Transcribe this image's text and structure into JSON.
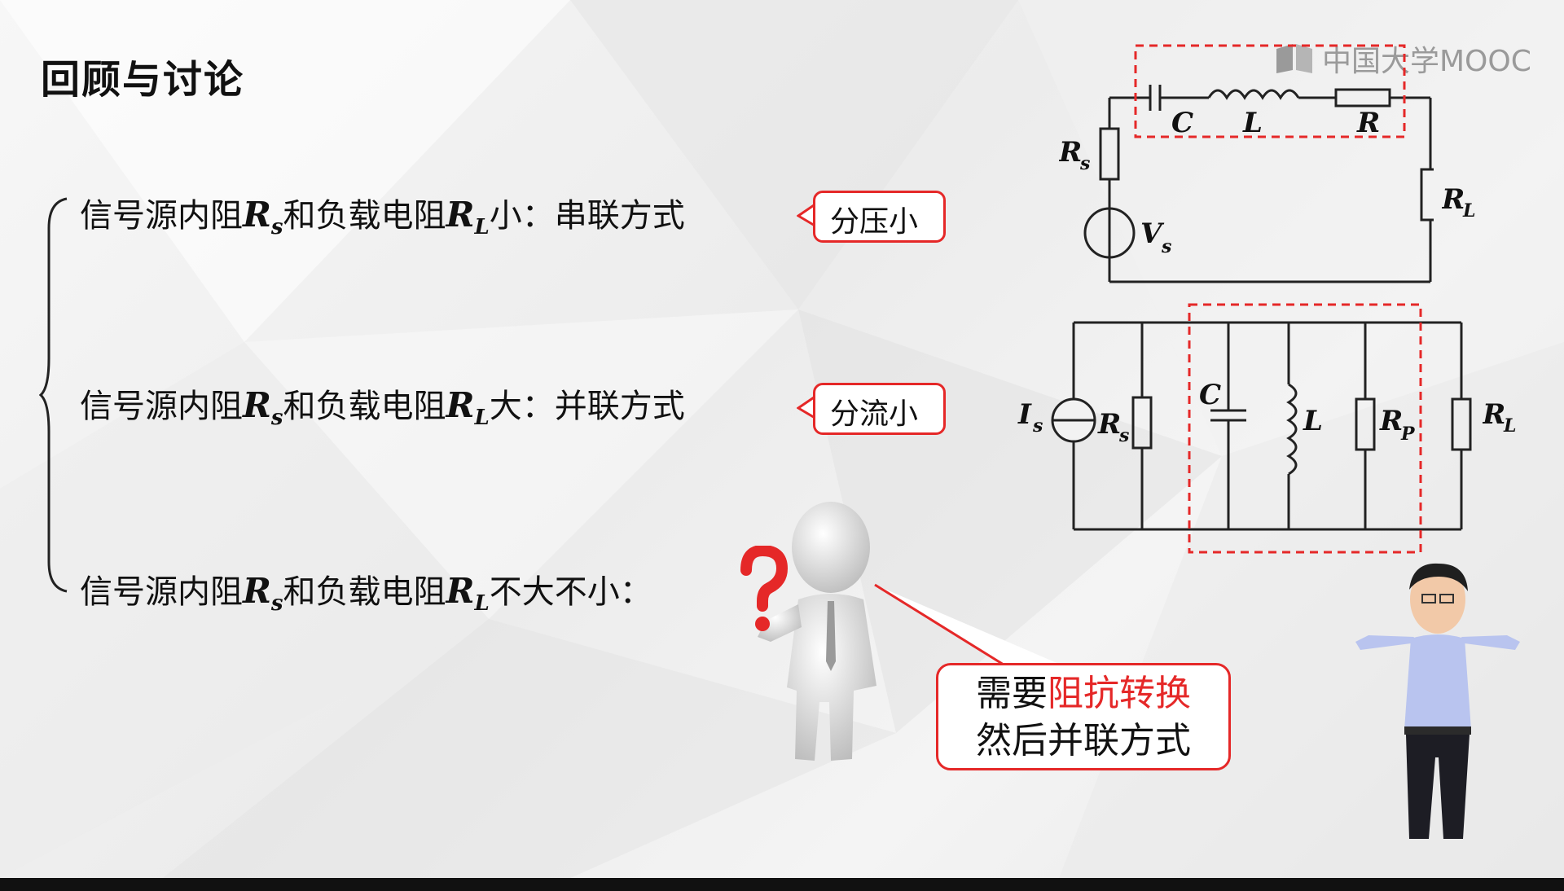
{
  "slide": {
    "title": "回顾与讨论",
    "watermark": "中国大学MOOC",
    "lines": [
      {
        "prefix": "信号源内阻",
        "rs": "R",
        "rs_sub": "s",
        "mid": "和负载电阻",
        "rl": "R",
        "rl_sub": "L",
        "suffix": "小：串联方式"
      },
      {
        "prefix": "信号源内阻",
        "rs": "R",
        "rs_sub": "s",
        "mid": "和负载电阻",
        "rl": "R",
        "rl_sub": "L",
        "suffix": "大：并联方式"
      },
      {
        "prefix": "信号源内阻",
        "rs": "R",
        "rs_sub": "s",
        "mid": "和负载电阻",
        "rl": "R",
        "rl_sub": "L",
        "suffix": "不大不小："
      }
    ],
    "callouts": [
      "分压小",
      "分流小"
    ],
    "note": {
      "line1_plain": "需要",
      "line1_highlight": "阻抗转换",
      "line2": "然后并联方式"
    }
  },
  "series_circuit": {
    "labels": {
      "C": "C",
      "L": "L",
      "R": "R",
      "Rs": "R",
      "Rs_sub": "s",
      "Vs": "V",
      "Vs_sub": "s",
      "RL": "R",
      "RL_sub": "L"
    }
  },
  "parallel_circuit": {
    "labels": {
      "Is": "I",
      "Is_sub": "s",
      "Rs": "R",
      "Rs_sub": "s",
      "C": "C",
      "L": "L",
      "Rp": "R",
      "Rp_sub": "P",
      "RL": "R",
      "RL_sub": "L"
    }
  },
  "colors": {
    "accent_red": "#e52828",
    "text": "#111111",
    "circuit": "#222222"
  }
}
